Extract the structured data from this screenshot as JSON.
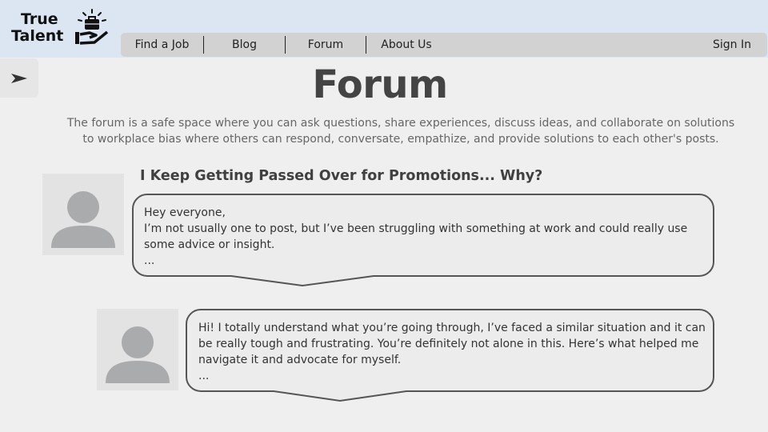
{
  "logo": {
    "line1": "True",
    "line2": "Talent",
    "icon": "briefcase-in-hand-icon"
  },
  "nav": {
    "items": [
      {
        "label": "Find a Job"
      },
      {
        "label": "Blog"
      },
      {
        "label": "Forum"
      },
      {
        "label": "About Us"
      }
    ],
    "sign_in": "Sign In"
  },
  "sidebar": {
    "toggle_icon": "send-arrow-icon"
  },
  "page": {
    "title": "Forum",
    "intro": "The forum is a safe space where you can ask questions, share experiences, discuss ideas, and collaborate on solutions to workplace bias where others can respond, conversate, empathize, and provide solutions to each other's posts."
  },
  "post": {
    "title": "I Keep Getting Passed Over for Promotions... Why?",
    "avatar_icon": "user-avatar-icon",
    "lines": [
      "Hey everyone,",
      "I’m not usually one to post, but I’ve been struggling with something at work and could really use",
      "some advice or insight.",
      "..."
    ]
  },
  "reply": {
    "avatar_icon": "user-avatar-icon",
    "lines": [
      "Hi! I totally understand what you’re going through, I’ve faced a similar situation and it can",
      "be really tough and frustrating. You’re definitely not alone in this. Here’s what helped me",
      "navigate it and advocate for myself.",
      "..."
    ]
  },
  "colors": {
    "header_bg": "#dce6f2",
    "nav_bg": "#d2d2d2",
    "page_bg": "#efefef",
    "bubble_border": "#555555"
  }
}
